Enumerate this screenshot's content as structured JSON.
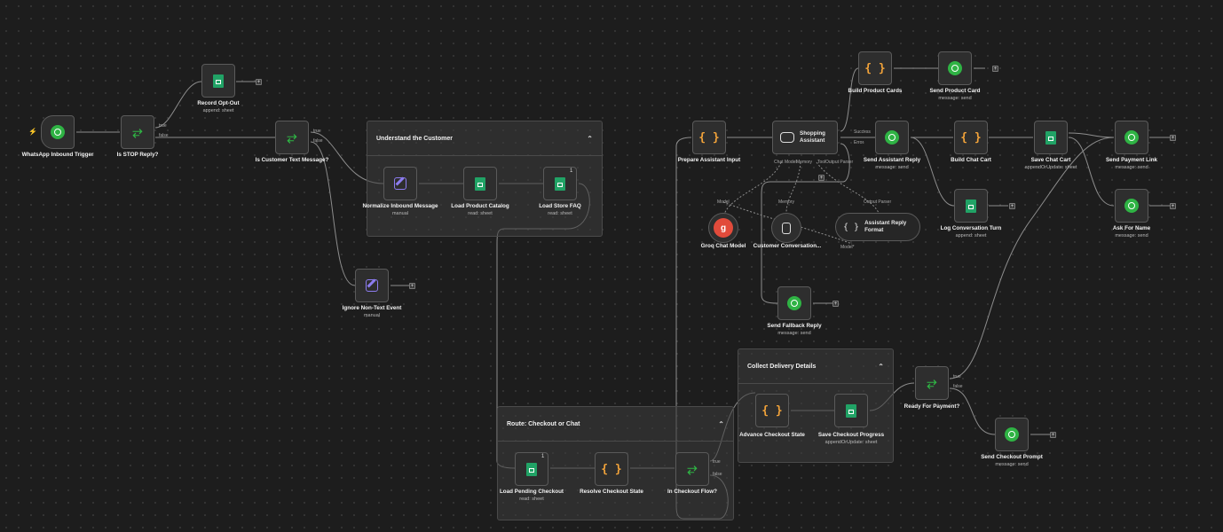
{
  "groups": {
    "understand": "Understand the Customer",
    "route": "Route: Checkout or Chat",
    "delivery": "Collect Delivery Details"
  },
  "group_toggle": "⌃",
  "nodes": {
    "trigger": {
      "label": "WhatsApp Inbound Trigger"
    },
    "is_stop": {
      "label": "Is STOP Reply?"
    },
    "opt_out": {
      "label": "Record Opt-Out",
      "sub": "append: sheet"
    },
    "is_text": {
      "label": "Is Customer Text Message?"
    },
    "ignore": {
      "label": "Ignore Non-Text Event",
      "sub": "manual"
    },
    "normalize": {
      "label": "Normalize Inbound Message",
      "sub": "manual"
    },
    "catalog": {
      "label": "Load Product Catalog",
      "sub": "read: sheet"
    },
    "faq": {
      "label": "Load Store FAQ",
      "sub": "read: sheet"
    },
    "prepare": {
      "label": "Prepare Assistant Input"
    },
    "assistant": {
      "label": "Shopping Assistant"
    },
    "build_cards": {
      "label": "Build Product Cards"
    },
    "send_card": {
      "label": "Send Product Card",
      "sub": "message: send"
    },
    "send_reply": {
      "label": "Send Assistant Reply",
      "sub": "message: send"
    },
    "build_cart": {
      "label": "Build Chat Cart"
    },
    "save_cart": {
      "label": "Save Chat Cart",
      "sub": "appendOrUpdate: sheet"
    },
    "pay_link": {
      "label": "Send Payment Link",
      "sub": "message: send"
    },
    "ask_name": {
      "label": "Ask For Name",
      "sub": "message: send"
    },
    "log_turn": {
      "label": "Log Conversation Turn",
      "sub": "append: sheet"
    },
    "groq": {
      "label": "Groq Chat Model"
    },
    "memory": {
      "label": "Customer Conversation..."
    },
    "parser": {
      "label": "Assistant Reply Format"
    },
    "fallback": {
      "label": "Send Fallback Reply",
      "sub": "message: send"
    },
    "advance": {
      "label": "Advance Checkout State"
    },
    "save_progress": {
      "label": "Save Checkout Progress",
      "sub": "appendOrUpdate: sheet"
    },
    "ready_pay": {
      "label": "Ready For Payment?"
    },
    "checkout_prompt": {
      "label": "Send Checkout Prompt",
      "sub": "message: send"
    },
    "load_pending": {
      "label": "Load Pending Checkout",
      "sub": "read: sheet"
    },
    "resolve": {
      "label": "Resolve Checkout State"
    },
    "in_checkout": {
      "label": "In Checkout Flow?"
    }
  },
  "port_labels": {
    "true": "true",
    "false": "false",
    "success": "Success",
    "error": "Error",
    "chat_model": "Chat Model",
    "memory": "Memory",
    "tool": "Tool",
    "output_parser": "Output Parser",
    "model": "Model",
    "model_req": "Model*"
  },
  "icons": {
    "whatsapp": "whatsapp-icon",
    "sheets": "google-sheets-icon",
    "code": "code-braces-icon",
    "if": "branch-icon",
    "edit": "edit-icon",
    "agent": "robot-icon",
    "groq": "groq-icon",
    "memory": "database-icon",
    "parser": "parser-icon",
    "bolt": "bolt-icon"
  },
  "glyphs": {
    "groq": "g",
    "code": "{ }",
    "bolt": "⚡",
    "plus": "+",
    "pin": "1"
  },
  "colors": {
    "canvas": "#1d1d1d",
    "whatsapp": "#2fb344",
    "sheets": "#21a366",
    "code": "#f2a33a",
    "if": "#2fb344",
    "edit": "#8c7cf0",
    "groq": "#e24b3b",
    "trigger_bolt": "#ff6d2d"
  }
}
